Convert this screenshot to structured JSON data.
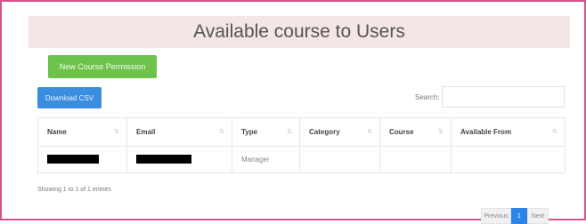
{
  "page": {
    "title": "Available course to Users",
    "new_button": "New Course Permission",
    "download_button": "Download CSV",
    "search_label": "Search:",
    "search_value": ""
  },
  "table": {
    "columns": [
      "Name",
      "Email",
      "Type",
      "Category",
      "Course",
      "Available From"
    ],
    "rows": [
      {
        "name": "",
        "email": "",
        "type": "Manager",
        "category": "",
        "course": "",
        "available_from": ""
      }
    ]
  },
  "footer": {
    "info": "Showing 1 to 1 of 1 entries",
    "prev": "Previous",
    "current_page": "1",
    "next": "Next"
  },
  "colors": {
    "accent_green": "#6cc24a",
    "accent_blue": "#3b8de0",
    "frame_border": "#d94f8c"
  }
}
